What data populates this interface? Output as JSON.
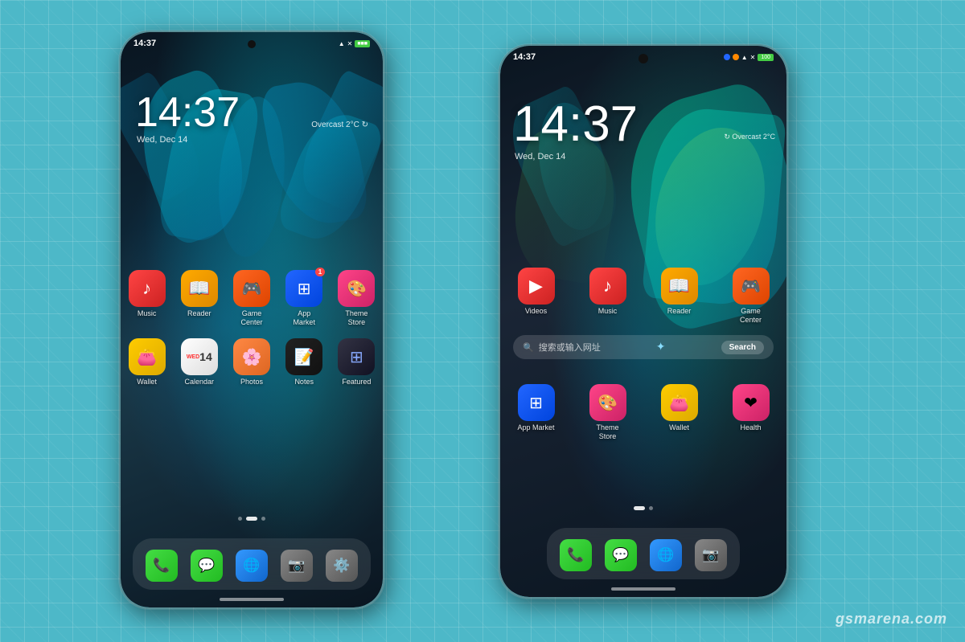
{
  "background": {
    "color": "#4db8c8",
    "grid": true
  },
  "watermark": "gsmarena.com",
  "phone_left": {
    "status_time": "14:37",
    "status_indicator": "green",
    "clock": "14:37",
    "date": "Wed, Dec 14",
    "weather": "Overcast 2°C",
    "apps_row1": [
      {
        "label": "Music",
        "icon": "music",
        "color": "icon-music"
      },
      {
        "label": "Reader",
        "icon": "📖",
        "color": "icon-reader"
      },
      {
        "label": "Game Center",
        "icon": "🎮",
        "color": "icon-gamecenter"
      },
      {
        "label": "App Market",
        "icon": "appmarket",
        "badge": "1",
        "color": "icon-appmarket"
      },
      {
        "label": "Theme Store",
        "icon": "🎨",
        "color": "icon-themestore"
      }
    ],
    "apps_row2": [
      {
        "label": "Wallet",
        "icon": "wallet",
        "color": "icon-wallet"
      },
      {
        "label": "Calendar",
        "icon": "14",
        "color": "icon-calendar"
      },
      {
        "label": "Photos",
        "icon": "photos",
        "color": "icon-photos"
      },
      {
        "label": "Notes",
        "icon": "notes",
        "color": "icon-notes"
      },
      {
        "label": "Featured",
        "icon": "featured",
        "color": "icon-featured"
      }
    ],
    "dock": [
      {
        "label": "Phone",
        "icon": "📞",
        "color": "icon-phone"
      },
      {
        "label": "Messages",
        "icon": "💬",
        "color": "icon-messages"
      },
      {
        "label": "Browser",
        "icon": "🌐",
        "color": "icon-browser"
      },
      {
        "label": "Camera",
        "icon": "📷",
        "color": "icon-camera"
      },
      {
        "label": "Settings",
        "icon": "⚙️",
        "color": "icon-settings"
      }
    ],
    "page_dots": [
      0,
      1,
      2
    ]
  },
  "phone_right": {
    "status_time": "14:37",
    "clock": "14:37",
    "date": "Wed, Dec 14",
    "weather": "Overcast 2°C",
    "apps_row1": [
      {
        "label": "Videos",
        "icon": "▶",
        "color": "icon-videos"
      },
      {
        "label": "Music",
        "icon": "♪",
        "color": "icon-music"
      },
      {
        "label": "Reader",
        "icon": "📖",
        "color": "icon-reader"
      },
      {
        "label": "Game Center",
        "icon": "🎮",
        "color": "icon-gamecenter"
      }
    ],
    "search": {
      "placeholder": "搜索或输入网址",
      "button": "Search"
    },
    "apps_row2": [
      {
        "label": "App Market",
        "icon": "appmarket",
        "color": "icon-appmarket"
      },
      {
        "label": "Theme Store",
        "icon": "🎨",
        "color": "icon-themestore"
      },
      {
        "label": "Wallet",
        "icon": "wallet",
        "color": "icon-wallet"
      },
      {
        "label": "Health",
        "icon": "health",
        "color": "icon-health"
      }
    ],
    "dock": [
      {
        "label": "Phone",
        "icon": "📞",
        "color": "icon-phone"
      },
      {
        "label": "Messages",
        "icon": "💬",
        "color": "icon-messages"
      },
      {
        "label": "Browser",
        "icon": "🌐",
        "color": "icon-browser"
      },
      {
        "label": "Camera",
        "icon": "📷",
        "color": "icon-camera"
      }
    ],
    "page_dots": [
      0,
      1
    ]
  }
}
